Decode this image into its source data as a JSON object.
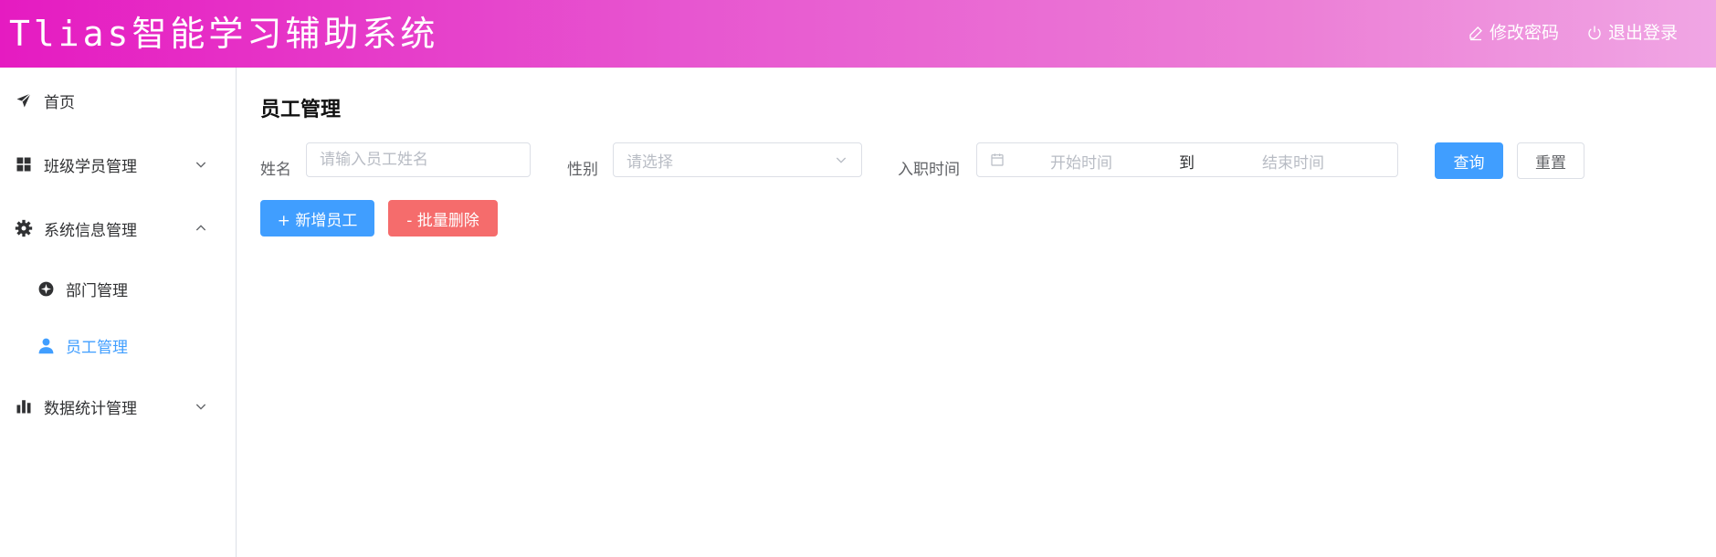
{
  "header": {
    "title": "Tlias智能学习辅助系统",
    "change_password": "修改密码",
    "logout": "退出登录",
    "edit_icon": "edit-icon",
    "power_icon": "power-icon"
  },
  "sidebar": {
    "items": [
      {
        "label": "首页",
        "icon": "paper-plane-icon"
      },
      {
        "label": "班级学员管理",
        "icon": "grid-icon",
        "arrow": "chevron-down-icon"
      },
      {
        "label": "系统信息管理",
        "icon": "gear-icon",
        "arrow": "chevron-up-icon"
      },
      {
        "label": "部门管理",
        "icon": "compass-icon"
      },
      {
        "label": "员工管理",
        "icon": "user-icon",
        "active": true
      },
      {
        "label": "数据统计管理",
        "icon": "bar-chart-icon",
        "arrow": "chevron-down-icon"
      }
    ]
  },
  "main": {
    "page_title": "员工管理",
    "search": {
      "name_label": "姓名",
      "name_placeholder": "请输入员工姓名",
      "gender_label": "性别",
      "gender_placeholder": "请选择",
      "date_label": "入职时间",
      "date_start_placeholder": "开始时间",
      "date_separator": "到",
      "date_end_placeholder": "结束时间",
      "query_button": "查询",
      "reset_button": "重置"
    },
    "actions": {
      "add_button": "+ 新增员工",
      "batch_delete_button": "- 批量删除"
    }
  },
  "colors": {
    "primary": "#409eff",
    "danger": "#f56c6c",
    "header_gradient_start": "#e51bc1",
    "header_gradient_end": "#f0a6e4"
  }
}
